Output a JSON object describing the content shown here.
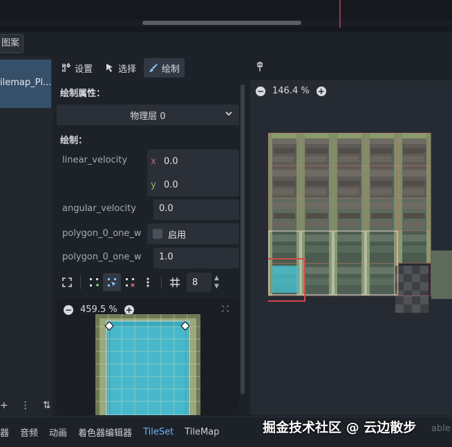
{
  "left_panel": {
    "tab_label": "图案",
    "selected_item": "ilemap_Pl..."
  },
  "toolbar": {
    "setup_label": "设置",
    "select_label": "选择",
    "paint_label": "绘制"
  },
  "inspector": {
    "props_heading": "绘制属性：",
    "physics_layer": "物理层 0",
    "paint_heading": "绘制：",
    "linear_velocity": {
      "label": "linear_velocity",
      "x_axis": "x",
      "x": "0.0",
      "y_axis": "y",
      "y": "0.0"
    },
    "angular_velocity": {
      "label": "angular_velocity",
      "value": "0.0"
    },
    "polygon_one_way": {
      "label": "polygon_0_one_w",
      "value": "启用"
    },
    "polygon_one_way_margin": {
      "label": "polygon_0_one_w",
      "value": "1.0"
    }
  },
  "tools": {
    "grid_size": "8"
  },
  "preview": {
    "zoom": "459.5 %"
  },
  "atlas": {
    "zoom": "146.4 %"
  },
  "bottom_bar": {
    "tabs": [
      "器",
      "音频",
      "动画",
      "着色器编辑器",
      "TileSet",
      "TileMap"
    ],
    "active_tab": "TileSet",
    "edge_text": "able"
  },
  "watermark": "掘金技术社区 @ 云边散步",
  "colors": {
    "accent": "#6cb3f5",
    "selection_red": "#d04a4a",
    "tile_overlay": "#44c5d8"
  }
}
